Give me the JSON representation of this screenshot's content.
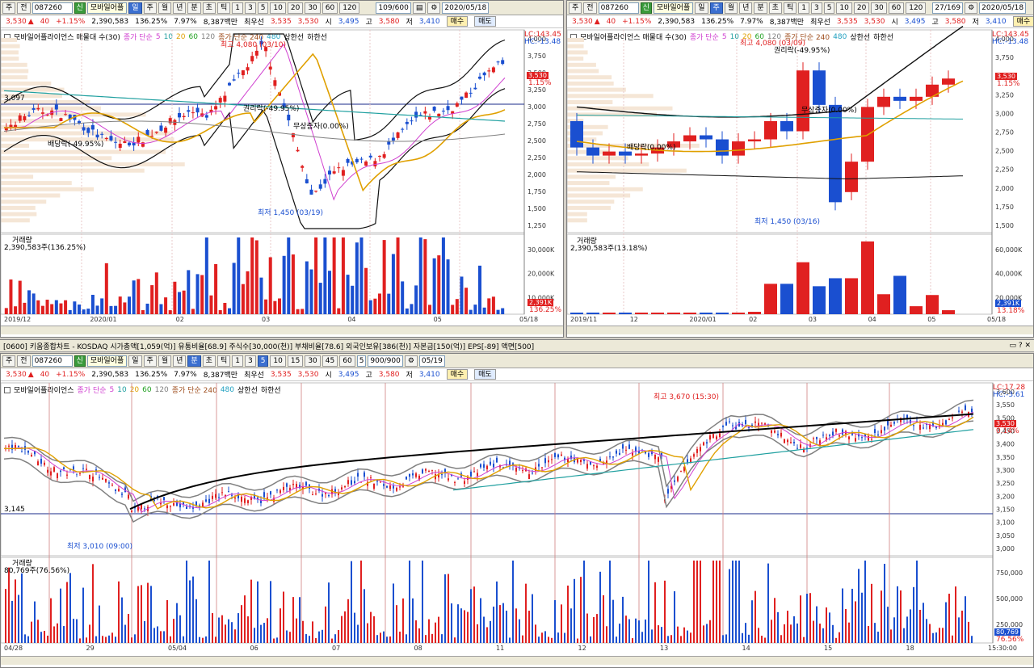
{
  "top": {
    "code": "087260",
    "stock_name": "모바일어플",
    "mode_type": "주",
    "mode_all": "전",
    "badge_new": "신",
    "periods": [
      "일",
      "주",
      "월",
      "년",
      "분",
      "초",
      "틱"
    ],
    "nums": [
      "1",
      "3",
      "5",
      "10",
      "20",
      "30",
      "60",
      "120"
    ],
    "date": "2020/05/18",
    "left_counter": "109/600",
    "right_counter": "27/169"
  },
  "quote": {
    "price": "3,530",
    "arrow": "▲",
    "change": "40",
    "rate": "+1.15%",
    "volume": "2,390,583",
    "ratio": "136.25%",
    "turnover": "7.97%",
    "amount": "8,387백만",
    "label_best": "최우선",
    "ask": "3,535",
    "bid": "3,530",
    "label_open": "시",
    "open": "3,495",
    "label_high": "고",
    "high": "3,580",
    "label_low": "저",
    "low": "3,410",
    "buy": "매수",
    "sell": "매도"
  },
  "charts": {
    "left": {
      "title": "모바일어플라이언스 매물대 수(30)",
      "ma_label": "종가 단순",
      "ma_periods": [
        "5",
        "10",
        "20",
        "60",
        "120"
      ],
      "ma_long": "종가 단순 240",
      "ma_480": "480",
      "upper": "상한선",
      "lower": "하한선",
      "lc": "LC:143.45",
      "hc": "HC:-13.48",
      "high_ann": "최고 4,080 (03/10)",
      "low_ann": "최저 1,450 (03/19)",
      "right_ann": "권리락(-49.95%)",
      "div_ann": "배당락(-49.95%)",
      "mid_ann": "무상증자(0.00%)",
      "hline": "3,097",
      "price_tag": "3,530",
      "pct_tag": "1.15%",
      "yticks": [
        "4,000",
        "3,750",
        "3,500",
        "3,250",
        "3,000",
        "2,750",
        "2,500",
        "2,250",
        "2,000",
        "1,750",
        "1,500",
        "1,250"
      ],
      "vol_title": "거래량",
      "vol_sub": "2,390,583주(136.25%)",
      "vol_ticks": [
        "30,000K",
        "20,000K",
        "10,000K"
      ],
      "vol_tag": "2,391K",
      "vol_pct": "136.25%",
      "xticks": [
        "2019/12",
        "2020/01",
        "02",
        "03",
        "04",
        "05",
        "05/18"
      ]
    },
    "right": {
      "title": "모바일어플라이언스 매물대 수(30)",
      "ma_label": "종가 단순",
      "ma_periods": [
        "5",
        "10",
        "20",
        "60",
        "120"
      ],
      "ma_long": "종가 단순 240",
      "ma_480": "480",
      "upper": "상한선",
      "lower": "하한선",
      "lc": "LC:143.45",
      "hc": "HC:-13.48",
      "high_ann": "최고 4,080 (03/09)",
      "low_ann": "최저 1,450 (03/16)",
      "right_ann": "권리락(-49.95%)",
      "div_ann": "배당락(0.00%)",
      "mid_ann": "무상증자(0.00%)",
      "price_tag": "3,530",
      "pct_tag": "1.15%",
      "yticks": [
        "4,000",
        "3,750",
        "3,500",
        "3,250",
        "3,000",
        "2,750",
        "2,500",
        "2,250",
        "2,000",
        "1,750",
        "1,500"
      ],
      "vol_title": "거래량",
      "vol_sub": "2,390,583주(13.18%)",
      "vol_ticks": [
        "60,000K",
        "40,000K",
        "20,000K"
      ],
      "vol_tag": "2,391K",
      "vol_pct": "13.18%",
      "xticks": [
        "2019/11",
        "12",
        "2020/01",
        "02",
        "03",
        "04",
        "05",
        "05/18"
      ]
    },
    "bottom": {
      "strip": "[0600] 키움종합차트 - KOSDAQ 시가총액[1,059(억)] 유통비율[68.9] 주식수[30,000(천)] 부채비율[78.6] 외국인보유[386(천)] 자본금[150(억)] EPS[-89] 액면[500]",
      "title": "모바일어플라이언스",
      "ma_label": "종가 단순",
      "ma_periods": [
        "5",
        "10",
        "20",
        "60",
        "120"
      ],
      "ma_long": "종가 단순 240",
      "ma_480": "480",
      "upper": "상한선",
      "lower": "하한선",
      "lc": "LC:17.28",
      "hc": "HC:-3.61",
      "high_ann": "최고 3,670 (15:30)",
      "low_ann": "최저 3,010 (09:00)",
      "hline": "3,145",
      "price_tag": "3,530",
      "pct_tag": "0.14%",
      "yticks": [
        "3,600",
        "3,550",
        "3,500",
        "3,450",
        "3,400",
        "3,350",
        "3,300",
        "3,250",
        "3,200",
        "3,150",
        "3,100",
        "3,050",
        "3,000"
      ],
      "vol_title": "거래량",
      "vol_sub": "80,769주(76.56%)",
      "vol_ticks": [
        "750,000",
        "500,000",
        "250,000"
      ],
      "vol_tag": "80,769",
      "vol_pct": "76.56%",
      "xticks": [
        "04/28",
        "29",
        "05/04",
        "06",
        "07",
        "08",
        "11",
        "12",
        "13",
        "14",
        "15",
        "18",
        "15:30:00"
      ],
      "counter": "900/900",
      "date": "05/19",
      "nums": [
        "1",
        "3",
        "5",
        "10",
        "15",
        "30",
        "45",
        "60"
      ],
      "sel_num": "5"
    }
  },
  "colors": {
    "up": "#e02020",
    "down": "#1a4fd0",
    "ma5": "#d040d0",
    "ma20": "#e0a000",
    "ma60": "#20a0a0",
    "bb": "#202020"
  }
}
